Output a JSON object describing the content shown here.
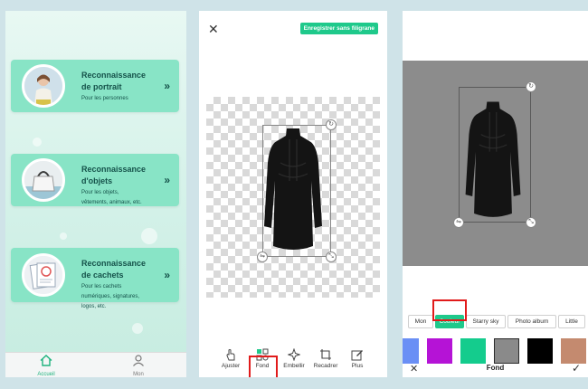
{
  "phone1": {
    "cards": [
      {
        "title_line1": "Reconnaissance",
        "title_line2": "de portrait",
        "desc_line1": "Pour les personnes",
        "desc_line2": "",
        "desc_line3": ""
      },
      {
        "title_line1": "Reconnaissance",
        "title_line2": "d'objets",
        "desc_line1": "Pour les objets,",
        "desc_line2": "vêtements, animaux, etc.",
        "desc_line3": ""
      },
      {
        "title_line1": "Reconnaissance",
        "title_line2": "de cachets",
        "desc_line1": "Pour les cachets",
        "desc_line2": "numériques, signatures,",
        "desc_line3": "logos, etc."
      }
    ],
    "arrow_glyph": "»",
    "tabs": [
      {
        "label": "Accueil"
      },
      {
        "label": "Mon"
      }
    ],
    "colors": {
      "card": "#88e4c6",
      "active_tab": "#1fb37e"
    }
  },
  "phone2": {
    "close_glyph": "✕",
    "save_label": "Enregistrer sans filigrane",
    "tools": [
      {
        "label": "Ajuster",
        "icon": "hand-icon"
      },
      {
        "label": "Fond",
        "icon": "background-icon"
      },
      {
        "label": "Embellir",
        "icon": "sparkle-icon"
      },
      {
        "label": "Recadrer",
        "icon": "crop-icon"
      },
      {
        "label": "Plus",
        "icon": "edit-icon"
      }
    ],
    "colors": {
      "accent": "#1fc98b",
      "highlight": "#e11b1b"
    }
  },
  "phone3": {
    "chips": [
      {
        "label": "Mon"
      },
      {
        "label": "Couleur"
      },
      {
        "label": "Starry sky"
      },
      {
        "label": "Photo album"
      },
      {
        "label": "Little"
      }
    ],
    "swatches": [
      "#6a8ff5",
      "#b513d6",
      "#14cc8d",
      "#8a8a8a",
      "#000000",
      "#c48a6f"
    ],
    "bottom_title": "Fond",
    "close_glyph": "✕",
    "confirm_glyph": "✓",
    "colors": {
      "canvas_bg": "#8c8c8c"
    }
  }
}
